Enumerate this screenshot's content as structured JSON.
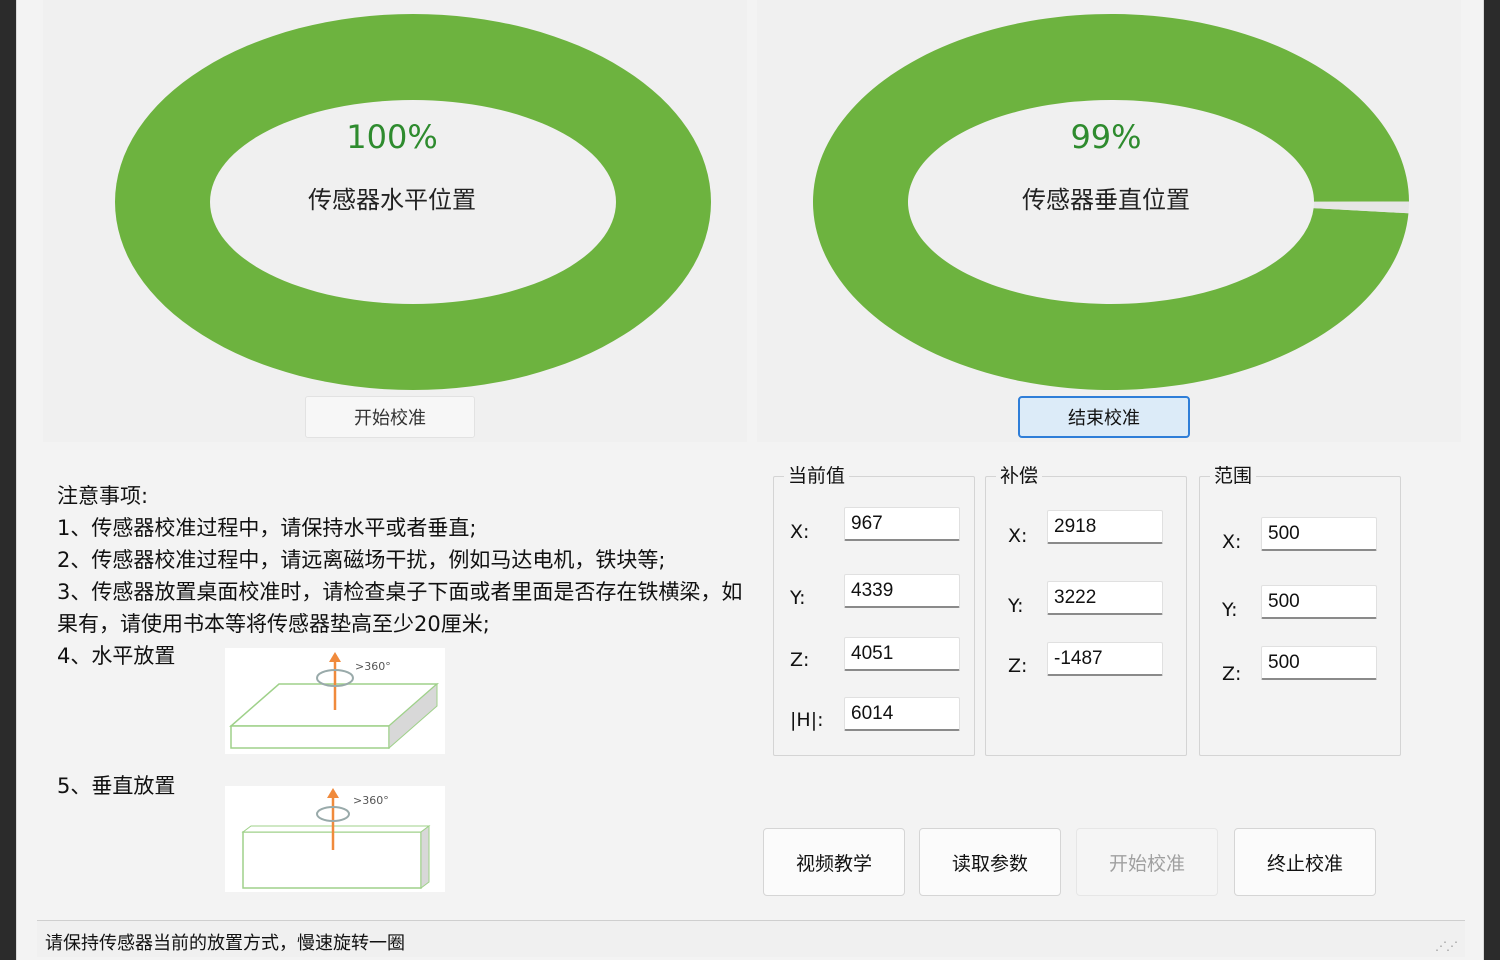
{
  "gauges": [
    {
      "percent_text": "100%",
      "value": 1.0,
      "label": "传感器水平位置",
      "button": "开始校准"
    },
    {
      "percent_text": "99%",
      "value": 0.99,
      "label": "传感器垂直位置",
      "button": "结束校准"
    }
  ],
  "colors": {
    "gauge_fill": "#6db33f",
    "gauge_remainder": "#e6e6e6",
    "percent_text": "#2e8b2e",
    "active_button_border": "#2f7ed8"
  },
  "notes": {
    "title": "注意事项:",
    "items": [
      "1、传感器校准过程中，请保持水平或者垂直;",
      "2、传感器校准过程中，请远离磁场干扰，例如马达电机，铁块等;",
      "3、传感器放置桌面校准时，请检查桌子下面或者里面是否存在铁横梁，如果有，请使用书本等将传感器垫高至少20厘米;",
      "4、水平放置",
      "5、垂直放置"
    ],
    "diagram_label": ">360°"
  },
  "groups": {
    "current": {
      "title": "当前值",
      "fields": [
        {
          "label": "X:",
          "value": "967"
        },
        {
          "label": "Y:",
          "value": "4339"
        },
        {
          "label": "Z:",
          "value": "4051"
        },
        {
          "label": "|H|:",
          "value": "6014"
        }
      ]
    },
    "compensation": {
      "title": "补偿",
      "fields": [
        {
          "label": "X:",
          "value": "2918"
        },
        {
          "label": "Y:",
          "value": "3222"
        },
        {
          "label": "Z:",
          "value": "-1487"
        }
      ]
    },
    "range": {
      "title": "范围",
      "fields": [
        {
          "label": "X:",
          "value": "500"
        },
        {
          "label": "Y:",
          "value": "500"
        },
        {
          "label": "Z:",
          "value": "500"
        }
      ]
    }
  },
  "buttons": {
    "video": "视频教学",
    "read": "读取参数",
    "start": "开始校准",
    "stop": "终止校准"
  },
  "status": "请保持传感器当前的放置方式，慢速旋转一圈"
}
